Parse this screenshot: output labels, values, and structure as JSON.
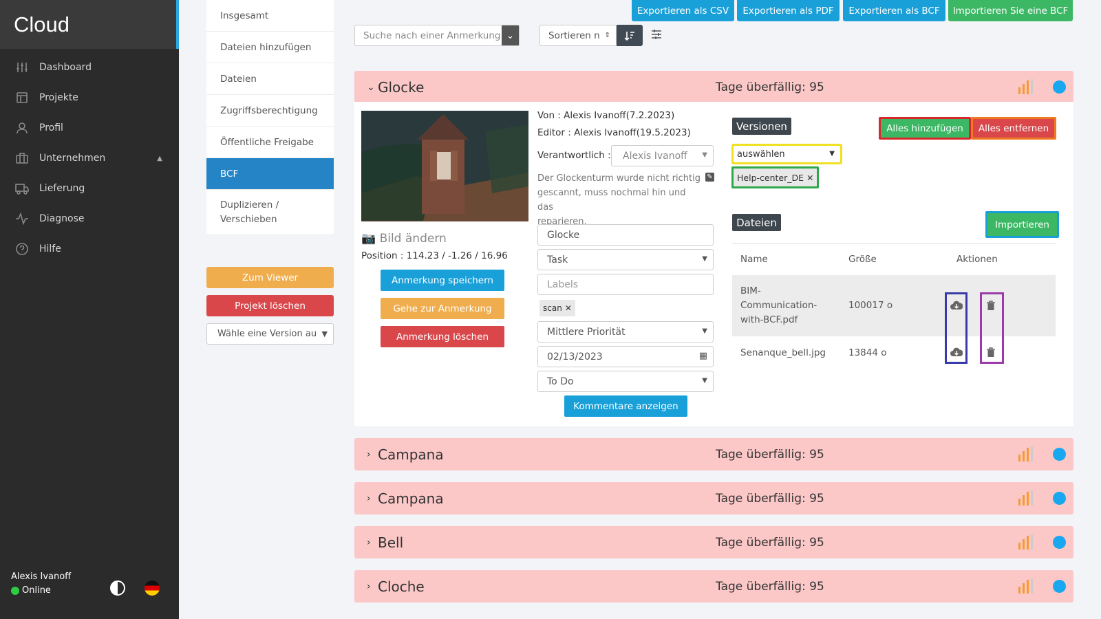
{
  "app": {
    "brand": "Cloud"
  },
  "sidebar": {
    "items": [
      {
        "label": "Dashboard",
        "icon": "sliders-icon"
      },
      {
        "label": "Projekte",
        "icon": "layout-icon"
      },
      {
        "label": "Profil",
        "icon": "user-icon"
      },
      {
        "label": "Unternehmen",
        "icon": "briefcase-icon"
      },
      {
        "label": "Lieferung",
        "icon": "truck-icon"
      },
      {
        "label": "Diagnose",
        "icon": "activity-icon"
      },
      {
        "label": "Hilfe",
        "icon": "help-icon"
      }
    ],
    "user": "Alexis Ivanoff",
    "status": "Online"
  },
  "subnav": {
    "items": [
      "Insgesamt",
      "Dateien hinzufügen",
      "Dateien",
      "Zugriffsberechtigung",
      "Öffentliche Freigabe",
      "BCF",
      "Duplizieren / Verschieben"
    ],
    "viewer_button": "Zum Viewer",
    "delete_project": "Projekt löschen",
    "version_select": "Wähle eine Version au"
  },
  "toolbar": {
    "export_csv": "Exportieren als CSV",
    "export_pdf": "Exportieren als PDF",
    "export_bcf": "Exportieren als BCF",
    "import_bcf": "Importieren Sie eine BCF",
    "search_placeholder": "Suche nach einer Anmerkung",
    "sort_label": "Sortieren n"
  },
  "issues": [
    {
      "title": "Glocke",
      "due": "Tage überfällig: 95"
    },
    {
      "title": "Campana",
      "due": "Tage überfällig: 95"
    },
    {
      "title": "Campana",
      "due": "Tage überfällig: 95"
    },
    {
      "title": "Bell",
      "due": "Tage überfällig: 95"
    },
    {
      "title": "Cloche",
      "due": "Tage überfällig: 95"
    }
  ],
  "detail": {
    "from": "Von : Alexis Ivanoff(7.2.2023)",
    "editor": "Editor : Alexis Ivanoff(19.5.2023)",
    "responsible_label": "Verantwortlich :",
    "responsible": "Alexis Ivanoff",
    "description_l1": "Der Glockenturm wurde nicht richtig",
    "description_l2": "gescannt, muss nochmal hin und das",
    "description_l3": "reparieren.",
    "change_image": "Bild ändern",
    "position": "Position : 114.23 / -1.26 / 16.96",
    "save": "Anmerkung speichern",
    "goto": "Gehe zur Anmerkung",
    "delete": "Anmerkung löschen",
    "title": "Glocke",
    "type": "Task",
    "labels_placeholder": "Labels",
    "label_tag": "scan",
    "priority": "Mittlere Priorität",
    "date": "02/13/2023",
    "status": "To Do",
    "comments": "Kommentare anzeigen"
  },
  "versions": {
    "heading": "Versionen",
    "add_all": "Alles hinzufügen",
    "remove_all": "Alles entfernen",
    "select": "auswählen",
    "tag": "Help-center_DE"
  },
  "files": {
    "heading": "Dateien",
    "import": "Importieren",
    "col_name": "Name",
    "col_size": "Größe",
    "col_actions": "Aktionen",
    "rows": [
      {
        "name_l1": "BIM-",
        "name_l2": "Communication-",
        "name_l3": "with-BCF.pdf",
        "size": "100017 o"
      },
      {
        "name": "Senanque_bell.jpg",
        "size": "13844 o"
      }
    ]
  },
  "colors": {
    "accent": "#2584c6",
    "header_bg": "#fbc7c7",
    "green": "#3cb764",
    "red": "#d9474b",
    "orange": "#f0ad4e",
    "cyan": "#1aa0d8"
  }
}
